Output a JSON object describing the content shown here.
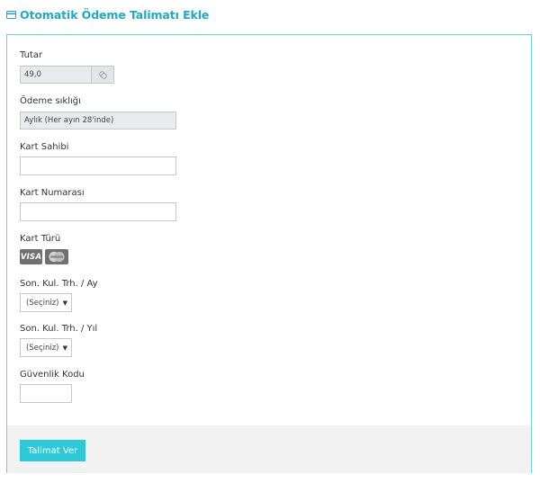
{
  "header": {
    "title": "Otomatik Ödeme Talimatı Ekle",
    "icon": "credit-card-icon",
    "accent_color": "#1faac1"
  },
  "form": {
    "amount": {
      "label": "Tutar",
      "value": "49,0"
    },
    "frequency": {
      "label": "Ödeme sıklığı",
      "value": "Aylık (Her ayın 28'inde)"
    },
    "card_holder": {
      "label": "Kart Sahibi",
      "value": ""
    },
    "card_number": {
      "label": "Kart Numarası",
      "value": ""
    },
    "card_type": {
      "label": "Kart Türü",
      "logos": [
        "VISA",
        "MasterCard"
      ]
    },
    "expiry_month": {
      "label": "Son. Kul. Trh. / Ay",
      "selected": "(Seçiniz)"
    },
    "expiry_year": {
      "label": "Son. Kul. Trh. / Yıl",
      "selected": "(Seçiniz)"
    },
    "security_code": {
      "label": "Güvenlik Kodu",
      "value": ""
    }
  },
  "actions": {
    "submit_label": "Talimat Ver",
    "submit_color": "#2ec8d6"
  }
}
